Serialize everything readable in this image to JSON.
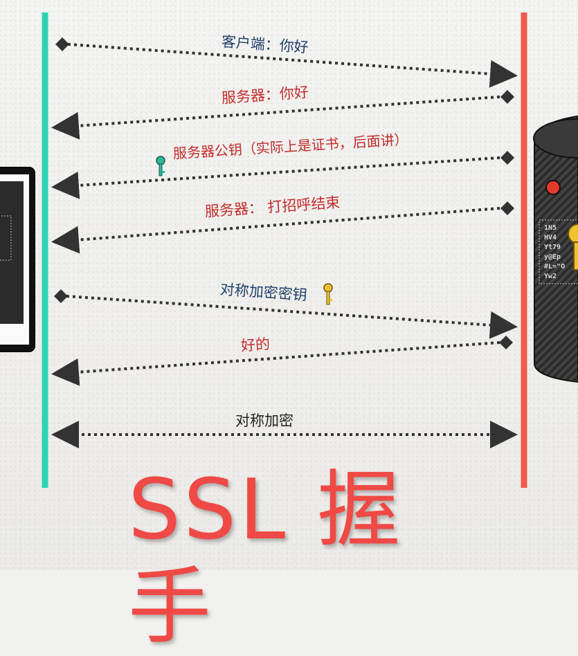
{
  "title": "SSL 握手",
  "messages": [
    {
      "text": "客户端：你好"
    },
    {
      "text": "服务器：你好"
    },
    {
      "text": "服务器公钥（实际上是证书，后面讲）"
    },
    {
      "text": "服务器： 打招呼结束"
    },
    {
      "text": "对称加密密钥"
    },
    {
      "text": "好的"
    },
    {
      "text": "对称加密"
    }
  ],
  "server_screen_text": [
    "1N5",
    "HV4",
    "Yt79",
    "y@Ep",
    "#L=\"O",
    "Yw2"
  ],
  "colors": {
    "client_line": "#2ed3b7",
    "server_line": "#f05a4f",
    "title": "#ef4a45",
    "label_blue": "#21406b",
    "label_red": "#c42b2b",
    "arrow": "#333333",
    "key_teal": "#2bb79c",
    "key_yellow": "#f2c12e"
  },
  "icons": [
    "client-device-icon",
    "server-database-icon",
    "key-icon"
  ]
}
